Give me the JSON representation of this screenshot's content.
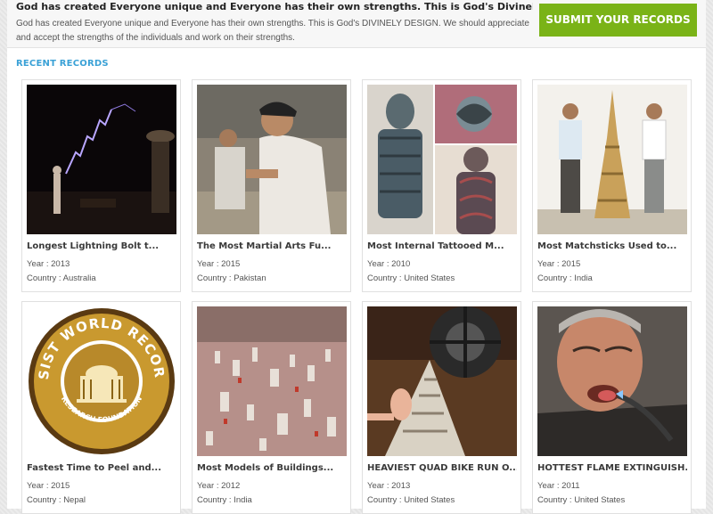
{
  "intro": {
    "heading": "God has created Everyone unique and Everyone has their own strengths. This is God's Divinely Design.",
    "body": "God has created Everyone unique and Everyone has their own strengths. This is God's DIVINELY DESIGN. We should appreciate and accept the strengths of the individuals and work on their strengths."
  },
  "submit_button": "SUBMIT YOUR RECORDS",
  "section_title": "RECENT RECORDS",
  "year_prefix": "Year : ",
  "country_prefix": "Country : ",
  "logo_text": {
    "top": "ASSIST WORLD RECORDS",
    "bottom": "RESEARCH FOUNDATION"
  },
  "records": [
    {
      "title": "Longest Lightning Bolt t...",
      "year": "2013",
      "country": "Australia",
      "image": "lightning-photo"
    },
    {
      "title": "The Most Martial Arts Fu...",
      "year": "2015",
      "country": "Pakistan",
      "image": "martial-arts-photo"
    },
    {
      "title": "Most Internal Tattooed M...",
      "year": "2010",
      "country": "United States",
      "image": "tattooed-man-photo"
    },
    {
      "title": "Most Matchsticks Used to...",
      "year": "2015",
      "country": "India",
      "image": "matchstick-tower-photo"
    },
    {
      "title": "Fastest Time to Peel and...",
      "year": "2015",
      "country": "Nepal",
      "image": "assist-world-records-logo"
    },
    {
      "title": "Most Models of Buildings...",
      "year": "2012",
      "country": "India",
      "image": "building-models-photo"
    },
    {
      "title": "HEAVIEST QUAD BIKE RUN O...",
      "year": "2013",
      "country": "United States",
      "image": "quad-bike-photo"
    },
    {
      "title": "HOTTEST FLAME EXTINGUISH...",
      "year": "2011",
      "country": "United States",
      "image": "flame-tongue-photo"
    }
  ],
  "colors": {
    "accent_green": "#7ab317",
    "section_blue": "#3aa1d6"
  }
}
